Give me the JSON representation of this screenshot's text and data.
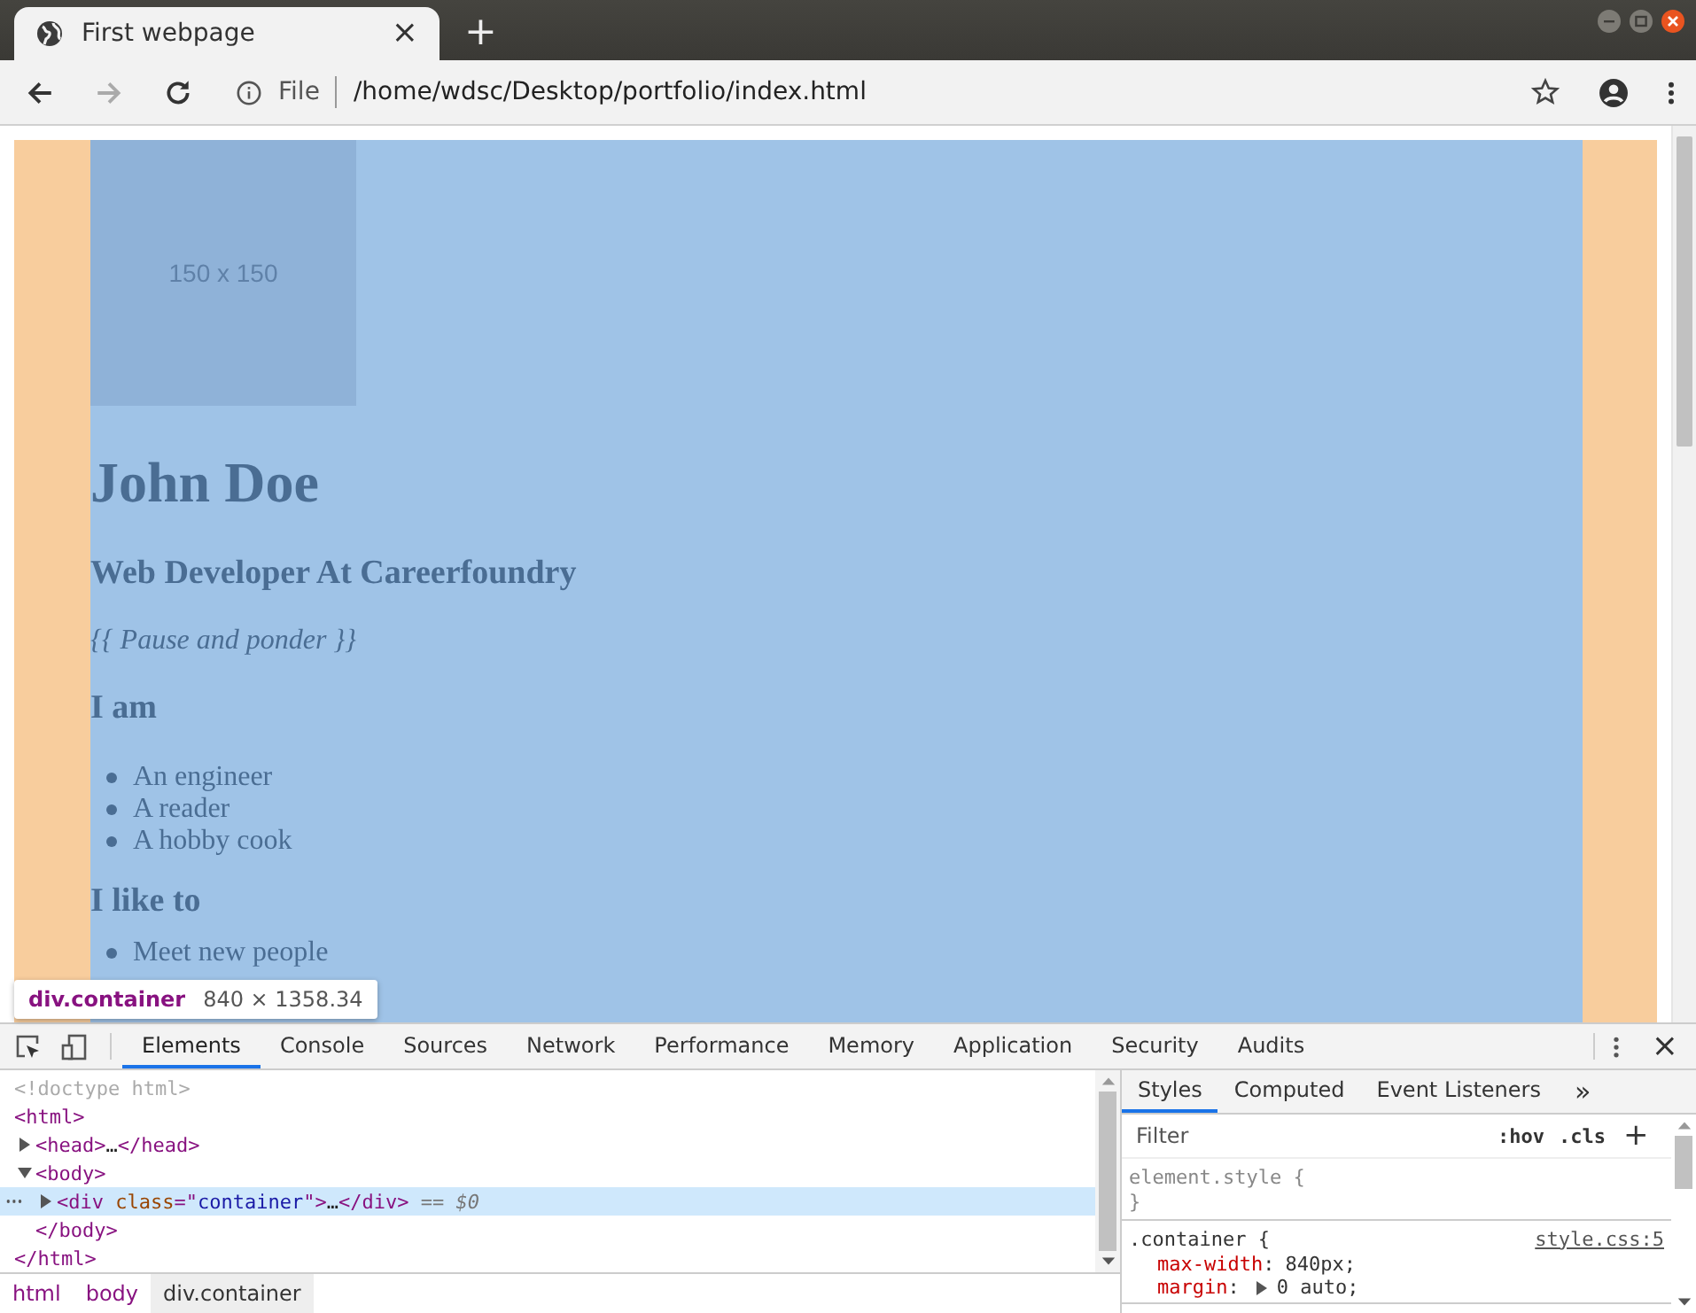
{
  "browser": {
    "tab": {
      "title": "First webpage",
      "close": "×"
    },
    "new_tab": "+",
    "address": {
      "scheme": "File",
      "url": "/home/wdsc/Desktop/portfolio/index.html"
    }
  },
  "page": {
    "image_placeholder": "150 x 150",
    "name": "John Doe",
    "role": "Web Developer At Careerfoundry",
    "tagline": "{{ Pause and ponder }}",
    "sections": [
      {
        "heading": "I am",
        "items": [
          "An engineer",
          "A reader",
          "A hobby cook"
        ]
      },
      {
        "heading": "I like to",
        "items": [
          "Meet new people"
        ]
      }
    ]
  },
  "inspect_tooltip": {
    "selector": "div.container",
    "size": "840 × 1358.34"
  },
  "devtools": {
    "tabs": [
      {
        "label": "Elements",
        "selected": true
      },
      {
        "label": "Console",
        "selected": false
      },
      {
        "label": "Sources",
        "selected": false
      },
      {
        "label": "Network",
        "selected": false
      },
      {
        "label": "Performance",
        "selected": false
      },
      {
        "label": "Memory",
        "selected": false
      },
      {
        "label": "Application",
        "selected": false
      },
      {
        "label": "Security",
        "selected": false
      },
      {
        "label": "Audits",
        "selected": false
      }
    ],
    "close": "×",
    "dom": [
      {
        "kind": "doctype",
        "tokens": [
          {
            "t": "<!doctype html>",
            "kind": "comment"
          }
        ]
      },
      {
        "kind": "element",
        "selected": false,
        "tokens": [
          {
            "t": "<html>",
            "kind": "tag"
          }
        ],
        "close_tokens": [
          {
            "t": "</html>",
            "kind": "tag"
          }
        ],
        "children": [
          {
            "kind": "element",
            "expanded": false,
            "selected": false,
            "tokens": [
              {
                "t": "<head>",
                "kind": "tag"
              },
              {
                "t": "…",
                "kind": "text"
              },
              {
                "t": "</head>",
                "kind": "tag"
              }
            ]
          },
          {
            "kind": "element",
            "expanded": true,
            "selected": false,
            "tokens": [
              {
                "t": "<body>",
                "kind": "tag"
              }
            ],
            "close_tokens": [
              {
                "t": "</body>",
                "kind": "tag"
              }
            ],
            "children": [
              {
                "kind": "element",
                "expanded": false,
                "selected": true,
                "tokens": [
                  {
                    "t": "<div",
                    "kind": "tag"
                  },
                  {
                    "t": " class",
                    "kind": "attr"
                  },
                  {
                    "t": "=\"",
                    "kind": "tag"
                  },
                  {
                    "t": "container",
                    "kind": "value"
                  },
                  {
                    "t": "\">",
                    "kind": "tag"
                  },
                  {
                    "t": "…",
                    "kind": "text"
                  },
                  {
                    "t": "</div>",
                    "kind": "tag"
                  },
                  {
                    "t": " == $0",
                    "kind": "hint"
                  }
                ]
              }
            ]
          }
        ]
      }
    ],
    "breadcrumbs": [
      {
        "label": "html",
        "selected": false
      },
      {
        "label": "body",
        "selected": false
      },
      {
        "label": "div.container",
        "selected": true
      }
    ],
    "side_tabs": [
      {
        "label": "Styles",
        "selected": true
      },
      {
        "label": "Computed",
        "selected": false
      },
      {
        "label": "Event Listeners",
        "selected": false
      }
    ],
    "side_more": "»",
    "filter": {
      "placeholder": "Filter"
    },
    "hov": ":hov",
    "cls": ".cls",
    "add": "+",
    "rules": [
      {
        "selector": "element.style",
        "open": "{",
        "close": "}"
      },
      {
        "selector": ".container",
        "open": "{",
        "source": "style.css:5",
        "declarations": [
          {
            "name": "max-width",
            "sep": ":",
            "value": "840px;"
          },
          {
            "name": "margin",
            "sep": ":",
            "value": "0 auto;",
            "expandable": true
          }
        ]
      }
    ]
  }
}
